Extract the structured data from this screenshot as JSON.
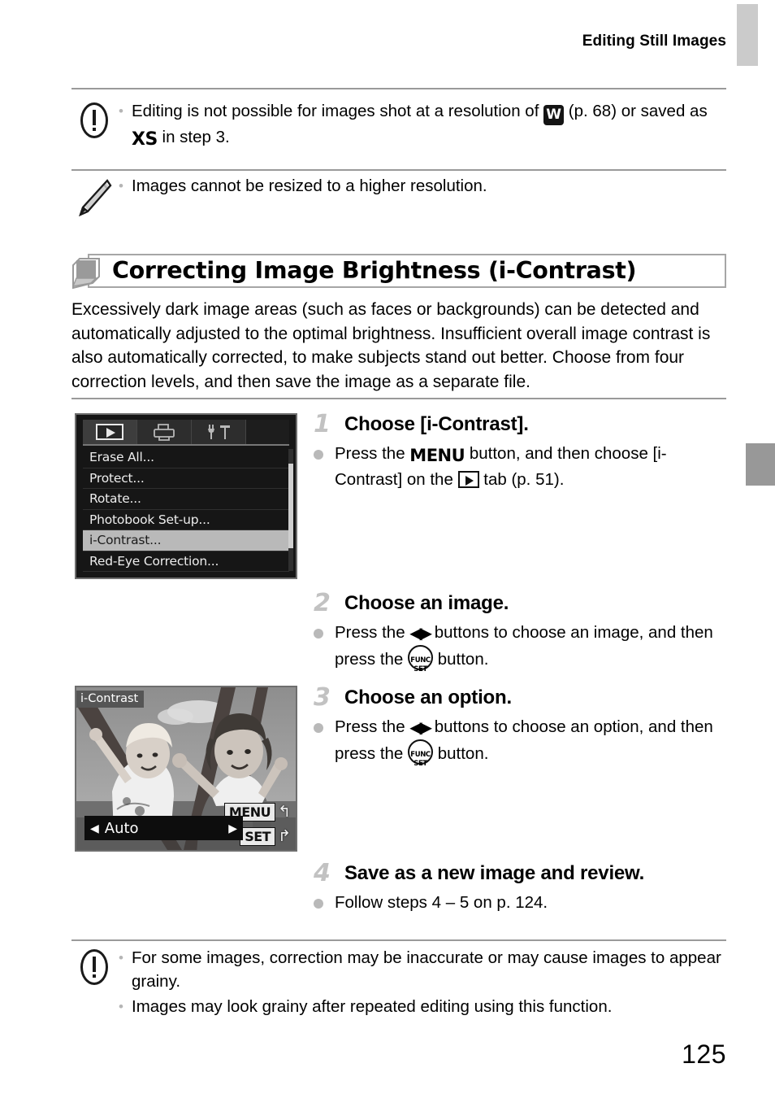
{
  "header": {
    "title": "Editing Still Images"
  },
  "caution_top": {
    "icon": "caution-icon",
    "items": [
      {
        "pre": "Editing is not possible for images shot at a resolution of ",
        "glyph1": "W",
        "mid": " (p. 68) or saved as ",
        "glyph2": "XS",
        "post": " in step 3."
      }
    ]
  },
  "note_tip": {
    "icon": "pencil-icon",
    "items": [
      "Images cannot be resized to a higher resolution."
    ]
  },
  "section": {
    "title": "Correcting Image Brightness (i-Contrast)",
    "intro": "Excessively dark image areas (such as faces or backgrounds) can be detected and automatically adjusted to the optimal brightness. Insufficient overall image contrast is also automatically corrected, to make subjects stand out better. Choose from four correction levels, and then save the image as a separate file."
  },
  "menu_screen": {
    "tabs": [
      {
        "name": "playback-tab",
        "icon": "play-icon",
        "active": true
      },
      {
        "name": "print-tab",
        "icon": "printer-icon",
        "active": false
      },
      {
        "name": "settings-tab",
        "icon": "wrench-hammer-icon",
        "active": false
      }
    ],
    "items": [
      {
        "label": "Erase All...",
        "selected": false
      },
      {
        "label": "Protect...",
        "selected": false
      },
      {
        "label": "Rotate...",
        "selected": false
      },
      {
        "label": "Photobook Set-up...",
        "selected": false
      },
      {
        "label": "i-Contrast...",
        "selected": true
      },
      {
        "label": "Red-Eye Correction...",
        "selected": false
      }
    ]
  },
  "photo_screen": {
    "badge": "i-Contrast",
    "option_value": "Auto",
    "arrow_left": "◀",
    "arrow_right": "▶",
    "hint_menu": "MENU",
    "hint_menu_glyph": "↰",
    "hint_set": "SET",
    "hint_set_glyph": "↱",
    "description": "Grayscale photo of two children on playground climbing bars"
  },
  "steps": [
    {
      "num": "1",
      "title": "Choose [i-Contrast].",
      "line1_pre": "Press the ",
      "line1_menu": "MENU",
      "line1_mid": " button, and then choose [i-Contrast] on the ",
      "line1_post": " tab (p. 51)."
    },
    {
      "num": "2",
      "title": "Choose an image.",
      "line1_pre": "Press the ",
      "line1_mid": " buttons to choose an image, and then press the ",
      "line1_post": " button."
    },
    {
      "num": "3",
      "title": "Choose an option.",
      "line1_pre": "Press the ",
      "line1_mid": " buttons to choose an option, and then press the ",
      "line1_post": " button."
    },
    {
      "num": "4",
      "title": "Save as a new image and review.",
      "line1_pre": "Follow steps 4 – 5 on p. 124."
    }
  ],
  "func_button": {
    "line1": "FUNC",
    "line2": "SET"
  },
  "caution_bottom": {
    "icon": "caution-icon",
    "items": [
      "For some images, correction may be inaccurate or may cause images to appear grainy.",
      "Images may look grainy after repeated editing using this function."
    ]
  },
  "page_number": "125",
  "colors": {
    "tab_light": "#cbcbcb",
    "tab_dark": "#989898",
    "rule": "#9a9a9a",
    "step_num": "#c2c2c2"
  }
}
